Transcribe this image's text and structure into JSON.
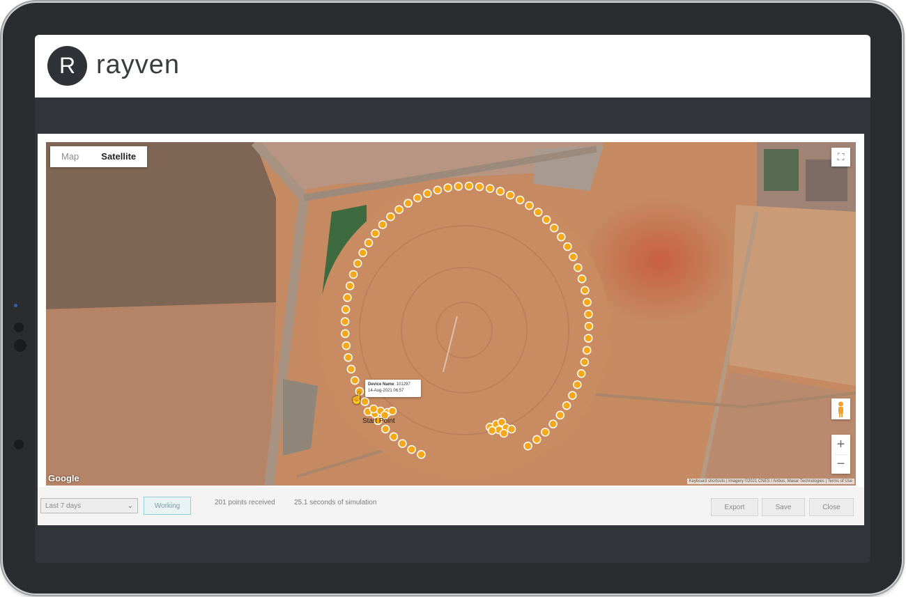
{
  "app": {
    "logo_letter": "R",
    "name": "rayven"
  },
  "map": {
    "type_buttons": {
      "map": "Map",
      "satellite": "Satellite",
      "active": "Satellite"
    },
    "zoom_in": "+",
    "zoom_out": "−",
    "fullscreen_icon": "fullscreen-icon",
    "pegman_icon": "pegman-icon",
    "google_logo": "Google",
    "attribution": "Keyboard shortcuts | Imagery ©2021 CNES / Airbus, Maxar Technologies | Terms of Use",
    "tooltip": {
      "title": "Device Name",
      "title_value": "101297",
      "timestamp": "14-Aug-2021 06:57"
    },
    "site_label": "Start Point",
    "marker_color": "#f4a81a"
  },
  "controls": {
    "range_select": "Last 7 days",
    "working_button": "Working",
    "points_received": "201 points received",
    "simulation_time": "25.1 seconds of simulation",
    "export_button": "Export",
    "save_button": "Save",
    "close_button": "Close"
  }
}
